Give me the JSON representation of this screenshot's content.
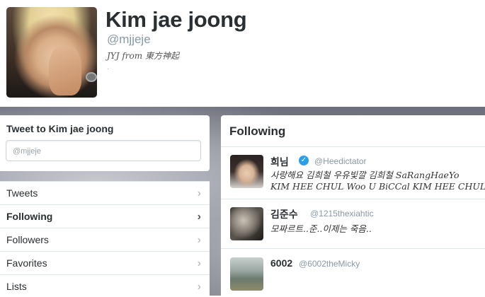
{
  "profile": {
    "name": "Kim jae joong",
    "handle": "@mjjeje",
    "bio": "JYJ from 東方神起",
    "extra": "."
  },
  "tweet_box": {
    "title": "Tweet to Kim jae joong",
    "placeholder": "@mjjeje"
  },
  "nav": {
    "items": [
      {
        "label": "Tweets",
        "active": false
      },
      {
        "label": "Following",
        "active": true
      },
      {
        "label": "Followers",
        "active": false
      },
      {
        "label": "Favorites",
        "active": false
      },
      {
        "label": "Lists",
        "active": false
      }
    ],
    "chevron": "›"
  },
  "following": {
    "title": "Following",
    "users": [
      {
        "name": "희님",
        "verified": true,
        "handle": "@Heedictator",
        "bio_line1": "사랑해요 김희철 우유빛깔 김희철 SaRangHaeYo",
        "bio_line2": "KIM HEE CHUL Woo U BiCCal KIM HEE CHUL"
      },
      {
        "name": "김준수",
        "verified": false,
        "handle": "@1215thexiahtic",
        "bio_line1": "모짜르트..준..이제는 죽음..",
        "bio_line2": ""
      },
      {
        "name": "6002",
        "verified": false,
        "handle": "@6002theMicky",
        "bio_line1": "",
        "bio_line2": ""
      }
    ]
  },
  "colors": {
    "accent": "#2b9ee8",
    "text": "#292f33",
    "muted": "#8899a6"
  }
}
